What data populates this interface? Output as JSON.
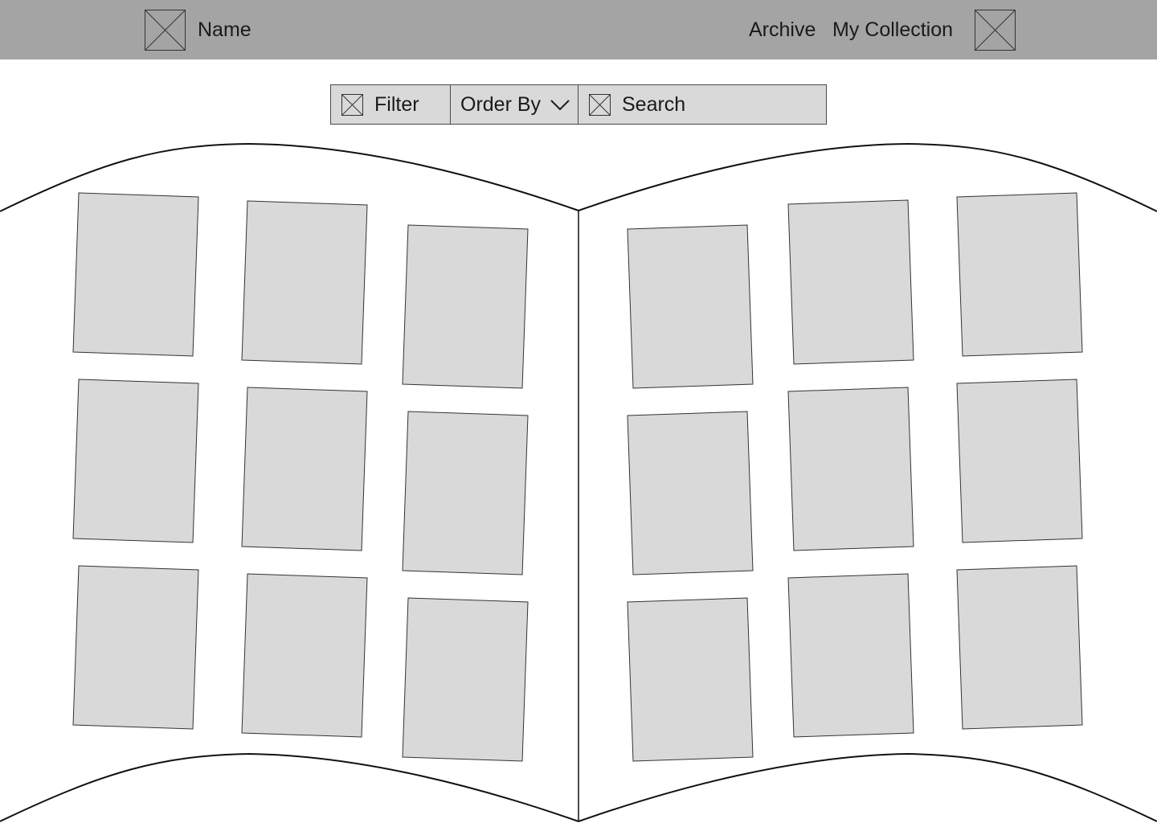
{
  "header": {
    "brand_icon": "image-placeholder-icon",
    "brand_name": "Name",
    "nav": {
      "archive": "Archive",
      "my_collection": "My Collection"
    },
    "avatar_icon": "image-placeholder-icon"
  },
  "toolbar": {
    "filter": {
      "icon": "image-placeholder-icon",
      "label": "Filter"
    },
    "order_by": {
      "label": "Order By",
      "icon": "chevron-down-icon"
    },
    "search": {
      "icon": "image-placeholder-icon",
      "label": "Search"
    }
  },
  "book": {
    "left_page_cards": 9,
    "right_page_cards": 9
  },
  "colors": {
    "header_bg": "#a4a4a4",
    "toolbar_bg": "#d9d9d9",
    "card_fill": "#d9d9d9",
    "page_bg": "#ffffff"
  }
}
